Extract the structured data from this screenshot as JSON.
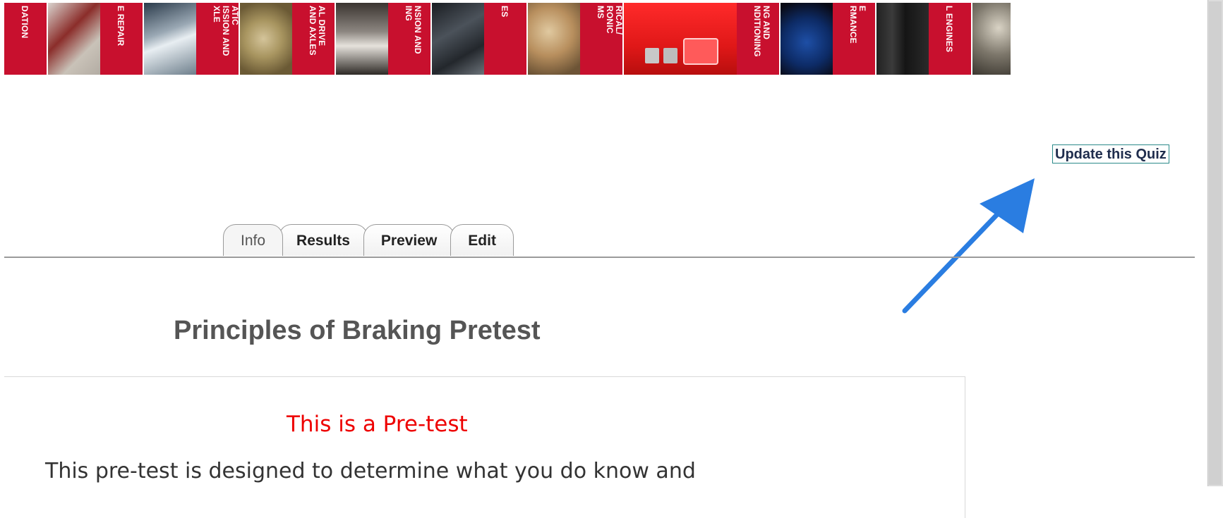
{
  "banner": {
    "spines": [
      "DATION",
      "E REPAIR",
      "ATIC\nISSION AND\nXLE",
      "AL DRIVE\nAND AXLES",
      "NSION AND\nING",
      "ES",
      "RICAL/\nRONIC\nMS",
      "NG AND\nNDITIONING",
      "E\nRMANCE",
      "L ENGINES"
    ]
  },
  "actions": {
    "update_quiz_label": "Update this Quiz"
  },
  "tabs": [
    {
      "label": "Info",
      "active": true
    },
    {
      "label": "Results",
      "active": false
    },
    {
      "label": "Preview",
      "active": false
    },
    {
      "label": "Edit",
      "active": false
    }
  ],
  "page": {
    "title": "Principles of Braking Pretest",
    "pretest_heading": "This is a Pre-test",
    "intro_text": "This pre-test is designed to determine what you do know and"
  },
  "colors": {
    "banner_red": "#c8102e",
    "arrow_blue": "#2a7de1",
    "heading_red": "#ee0000"
  }
}
